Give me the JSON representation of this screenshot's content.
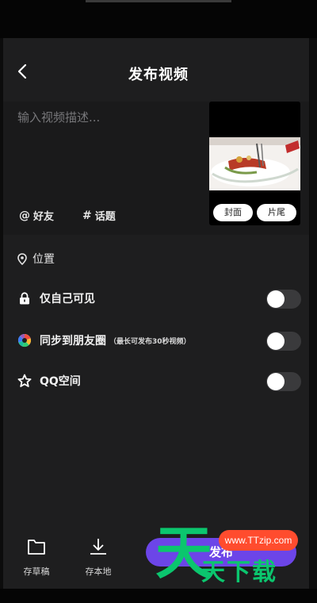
{
  "header": {
    "title": "发布视频",
    "back_icon": "chevron-left-icon"
  },
  "compose": {
    "description_placeholder": "输入视频描述...",
    "description_value": "",
    "mention_symbol": "@",
    "mention_label": "好友",
    "topic_symbol": "#",
    "topic_label": "话题"
  },
  "thumbnail": {
    "cover_label": "封面",
    "end_label": "片尾"
  },
  "location": {
    "icon": "location-pin-icon",
    "label": "位置"
  },
  "settings": [
    {
      "icon": "lock-icon",
      "label": "仅自己可见",
      "note": "",
      "on": false
    },
    {
      "icon": "moments-icon",
      "label": "同步到朋友圈",
      "note": "（最长可发布30秒视频）",
      "on": false
    },
    {
      "icon": "star-icon",
      "label": "QQ空间",
      "note": "",
      "on": false
    }
  ],
  "bottom": {
    "draft_label": "存草稿",
    "local_label": "存本地",
    "publish_label": "发布"
  },
  "watermark": {
    "big_char": "天",
    "text": "天下载",
    "site": "www.TTzip.com"
  },
  "colors": {
    "background": "#1e1e1f",
    "accent": "#6c45e8",
    "watermark_green": "#0bc66e",
    "watermark_red": "#ff4c2e"
  }
}
